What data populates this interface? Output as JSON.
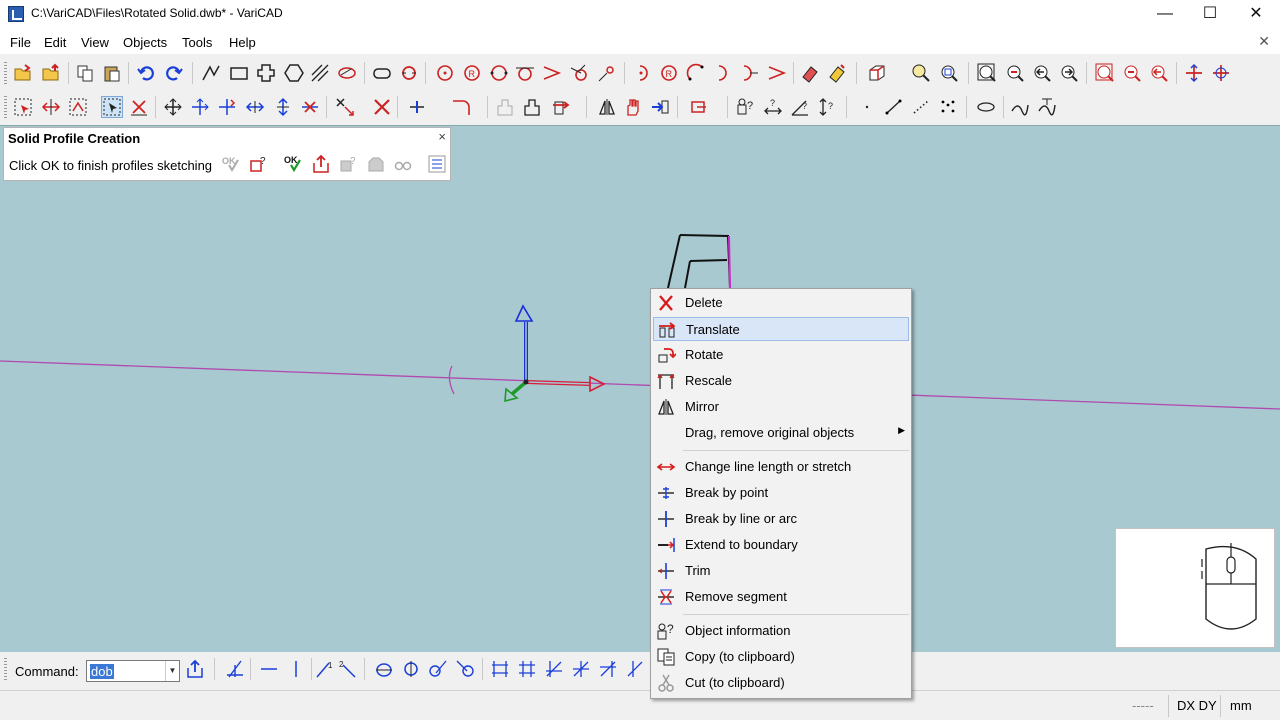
{
  "window": {
    "title": "C:\\VariCAD\\Files\\Rotated Solid.dwb* - VariCAD",
    "minimize": "—",
    "maximize": "☐",
    "close": "✕"
  },
  "menubar": {
    "items": [
      "File",
      "Edit",
      "View",
      "Objects",
      "Tools",
      "Help"
    ],
    "mdi_close": "✕"
  },
  "profile_panel": {
    "title": "Solid Profile Creation",
    "close": "×",
    "hint": "Click OK to finish profiles sketching",
    "ok_label": "OK"
  },
  "context_menu": {
    "items": [
      {
        "label": "Delete",
        "icon": "delete-icon"
      },
      {
        "label": "Translate",
        "icon": "translate-icon",
        "hovered": true
      },
      {
        "label": "Rotate",
        "icon": "rotate-icon"
      },
      {
        "label": "Rescale",
        "icon": "rescale-icon"
      },
      {
        "label": "Mirror",
        "icon": "mirror-icon"
      },
      {
        "label": "Drag, remove original objects",
        "icon": "",
        "submenu": true
      },
      {
        "label": "Change line length or stretch",
        "icon": "stretch-icon"
      },
      {
        "label": "Break by point",
        "icon": "break-point-icon"
      },
      {
        "label": "Break by line or arc",
        "icon": "break-line-icon"
      },
      {
        "label": "Extend to boundary",
        "icon": "extend-icon"
      },
      {
        "label": "Trim",
        "icon": "trim-icon"
      },
      {
        "label": "Remove segment",
        "icon": "remove-segment-icon"
      },
      {
        "label": "Object information",
        "icon": "object-info-icon"
      },
      {
        "label": "Copy (to clipboard)",
        "icon": "copy-icon"
      },
      {
        "label": "Cut (to clipboard)",
        "icon": "cut-icon"
      }
    ],
    "submenu_arrow": "▶"
  },
  "command_bar": {
    "label": "Command:",
    "value": "dob",
    "dropdown": "▼"
  },
  "status_bar": {
    "dashes": "-----",
    "coords_mode": "DX DY",
    "units": "mm"
  },
  "colors": {
    "canvas": "#a9c9d0",
    "profile_line": "#b04ab0",
    "axis_x": "#d81b3a",
    "axis_y": "#1a2fd8",
    "axis_z": "#1f9a2a",
    "selection_highlight": "#3a78d6"
  }
}
